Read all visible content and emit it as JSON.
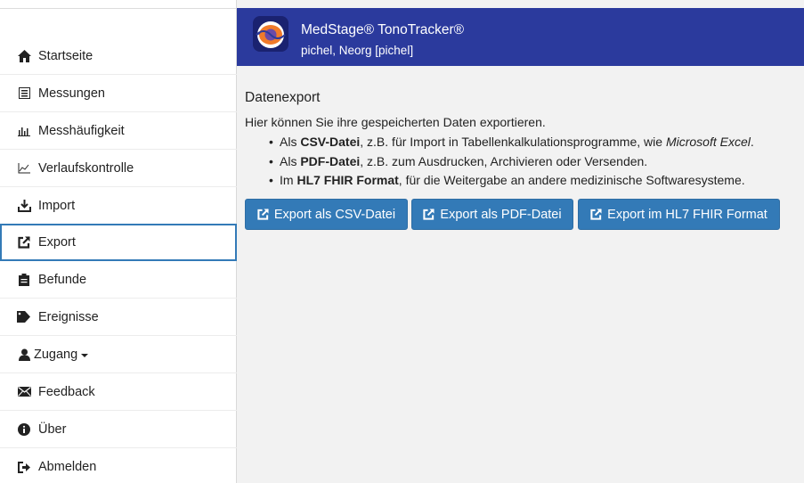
{
  "sidebar": {
    "items": [
      {
        "label": "Startseite",
        "icon": "home-icon"
      },
      {
        "label": "Messungen",
        "icon": "list-icon"
      },
      {
        "label": "Messhäufigkeit",
        "icon": "bar-chart-icon"
      },
      {
        "label": "Verlaufskontrolle",
        "icon": "line-chart-icon"
      },
      {
        "label": "Import",
        "icon": "import-icon"
      },
      {
        "label": "Export",
        "icon": "export-icon",
        "active": true
      },
      {
        "label": "Befunde",
        "icon": "clipboard-icon"
      },
      {
        "label": "Ereignisse",
        "icon": "tag-icon"
      },
      {
        "label": "Zugang",
        "icon": "user-icon"
      },
      {
        "label": "Feedback",
        "icon": "envelope-icon"
      },
      {
        "label": "Über",
        "icon": "info-icon"
      },
      {
        "label": "Abmelden",
        "icon": "logout-icon"
      }
    ]
  },
  "header": {
    "title": "MedStage® TonoTracker®",
    "user": "pichel, Neorg [pichel]"
  },
  "main": {
    "title": "Datenexport",
    "intro": "Hier können Sie ihre gespeicherten Daten exportieren.",
    "bullets": [
      {
        "pre": "Als ",
        "bold": "CSV-Datei",
        "post": ", z.B. für Import in Tabellenkalkulationsprogramme, wie ",
        "italic": "Microsoft Excel",
        "end": "."
      },
      {
        "pre": "Als ",
        "bold": "PDF-Datei",
        "post": ", z.B. zum Ausdrucken, Archivieren oder Versenden.",
        "italic": "",
        "end": ""
      },
      {
        "pre": "Im ",
        "bold": "HL7 FHIR Format",
        "post": ", für die Weitergabe an andere medizinische Softwaresysteme.",
        "italic": "",
        "end": ""
      }
    ],
    "buttons": {
      "csv": "Export als CSV-Datei",
      "pdf": "Export als PDF-Datei",
      "fhir": "Export im HL7 FHIR Format"
    }
  },
  "colors": {
    "header_bg": "#2b3a9d",
    "button_bg": "#337ab7",
    "active_border": "#337ab7"
  }
}
